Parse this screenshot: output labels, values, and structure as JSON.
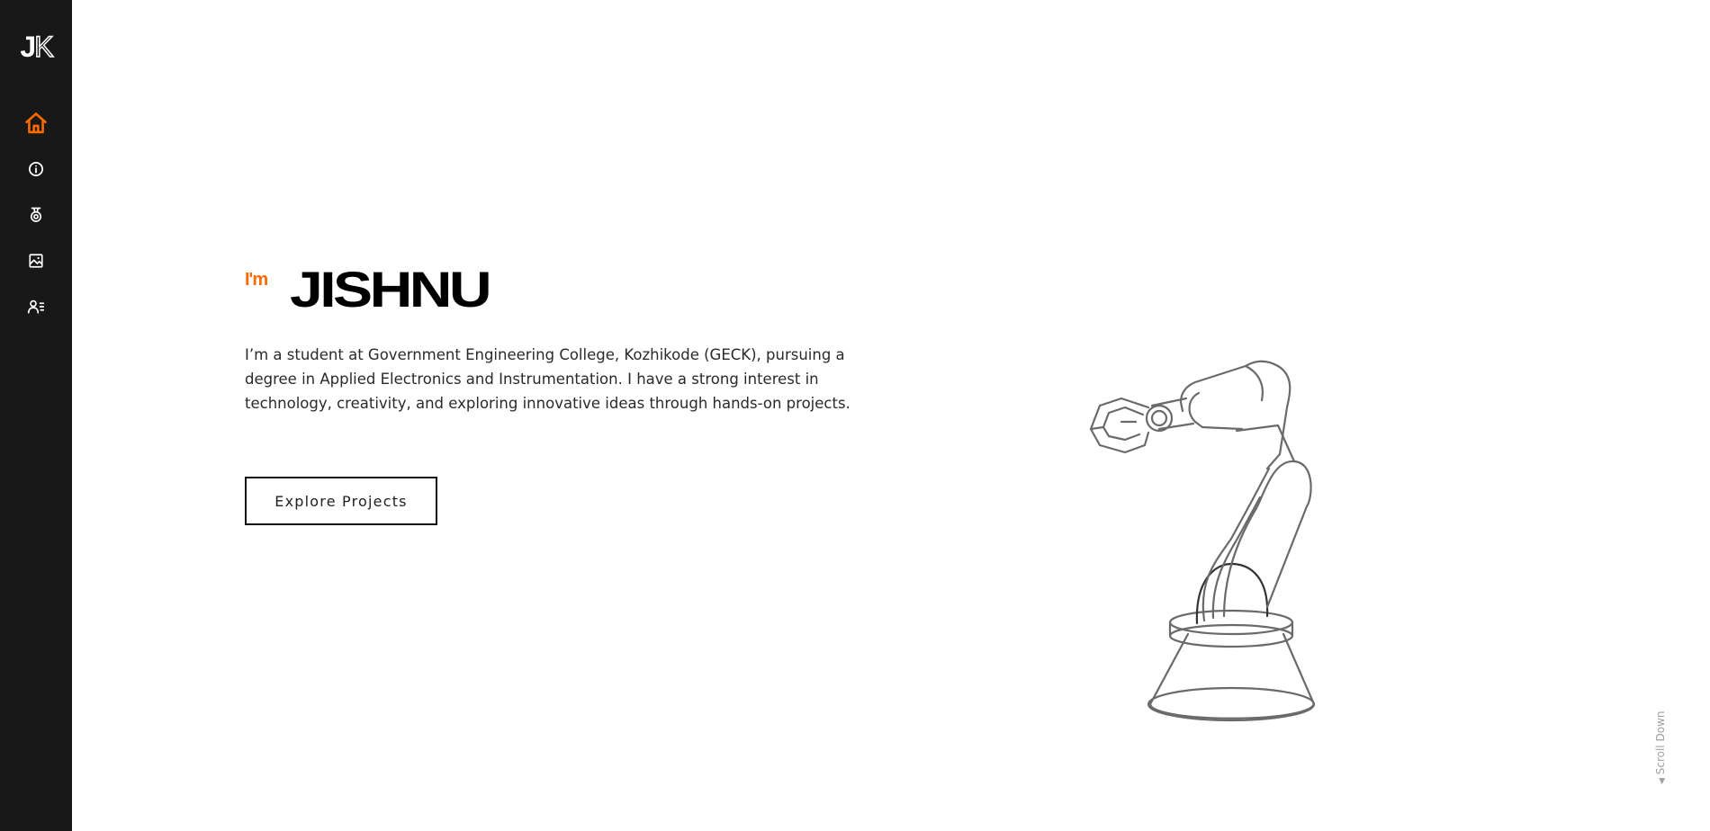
{
  "sidebar": {
    "logo": {
      "j": "J",
      "k": "K"
    },
    "items": [
      {
        "icon": "home-icon",
        "label": "Home",
        "active": true
      },
      {
        "icon": "info-icon",
        "label": "About",
        "active": false
      },
      {
        "icon": "medal-icon",
        "label": "Achievements",
        "active": false
      },
      {
        "icon": "gallery-icon",
        "label": "Gallery",
        "active": false
      },
      {
        "icon": "contact-icon",
        "label": "Contact",
        "active": false
      }
    ],
    "colors": {
      "background": "#181818",
      "icon": "#ffffff",
      "active": "#ff6a00"
    }
  },
  "hero": {
    "prefix": "I'm",
    "name": "JISHNU",
    "description": "I’m a student at Government Engineering College, Kozhikode (GECK), pursuing a degree in Applied Electronics and Instrumentation. I have a strong interest in technology, creativity, and exploring innovative ideas through hands-on projects.",
    "cta_label": "Explore Projects",
    "illustration": "robotic-arm-illustration"
  },
  "scroll_hint": {
    "label": "Scroll Down",
    "icon": "arrow-down-icon"
  },
  "colors": {
    "accent": "#ff6a00",
    "text": "#2a2a2a"
  }
}
